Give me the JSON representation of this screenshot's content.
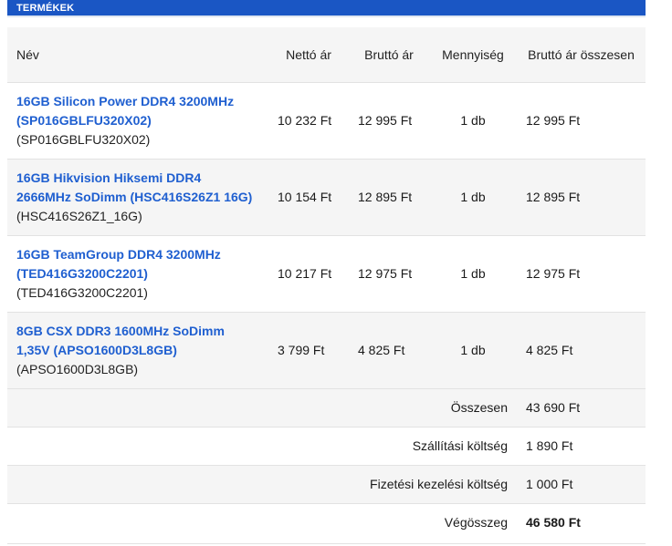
{
  "section": {
    "title": "TERMÉKEK"
  },
  "table": {
    "headers": {
      "name": "Név",
      "net_price": "Nettó ár",
      "gross_price": "Bruttó ár",
      "quantity": "Mennyiség",
      "gross_total": "Bruttó ár összesen"
    },
    "rows": [
      {
        "name": "16GB Silicon Power DDR4 3200MHz (SP016GBLFU320X02)",
        "code": "(SP016GBLFU320X02)",
        "net": "10 232 Ft",
        "gross": "12 995 Ft",
        "qty": "1 db",
        "total": "12 995 Ft"
      },
      {
        "name": "16GB Hikvision Hiksemi DDR4 2666MHz SoDimm (HSC416S26Z1 16G)",
        "code": "(HSC416S26Z1_16G)",
        "net": "10 154 Ft",
        "gross": "12 895 Ft",
        "qty": "1 db",
        "total": "12 895 Ft"
      },
      {
        "name": "16GB TeamGroup DDR4 3200MHz (TED416G3200C2201)",
        "code": "(TED416G3200C2201)",
        "net": "10 217 Ft",
        "gross": "12 975 Ft",
        "qty": "1 db",
        "total": "12 975 Ft"
      },
      {
        "name": "8GB CSX DDR3 1600MHz SoDimm 1,35V (APSO1600D3L8GB)",
        "code": "(APSO1600D3L8GB)",
        "net": "3 799 Ft",
        "gross": "4 825 Ft",
        "qty": "1 db",
        "total": "4 825 Ft"
      }
    ]
  },
  "summary": {
    "subtotal_label": "Összesen",
    "subtotal_value": "43 690 Ft",
    "shipping_label": "Szállítási költség",
    "shipping_value": "1 890 Ft",
    "payment_label": "Fizetési kezelési költség",
    "payment_value": "1 000 Ft",
    "total_label": "Végösszeg",
    "total_value": "46 580 Ft"
  },
  "colors": {
    "header_bar": "#1a56c4",
    "product_link": "#1f5fd0",
    "row_alt": "#f5f5f5"
  }
}
